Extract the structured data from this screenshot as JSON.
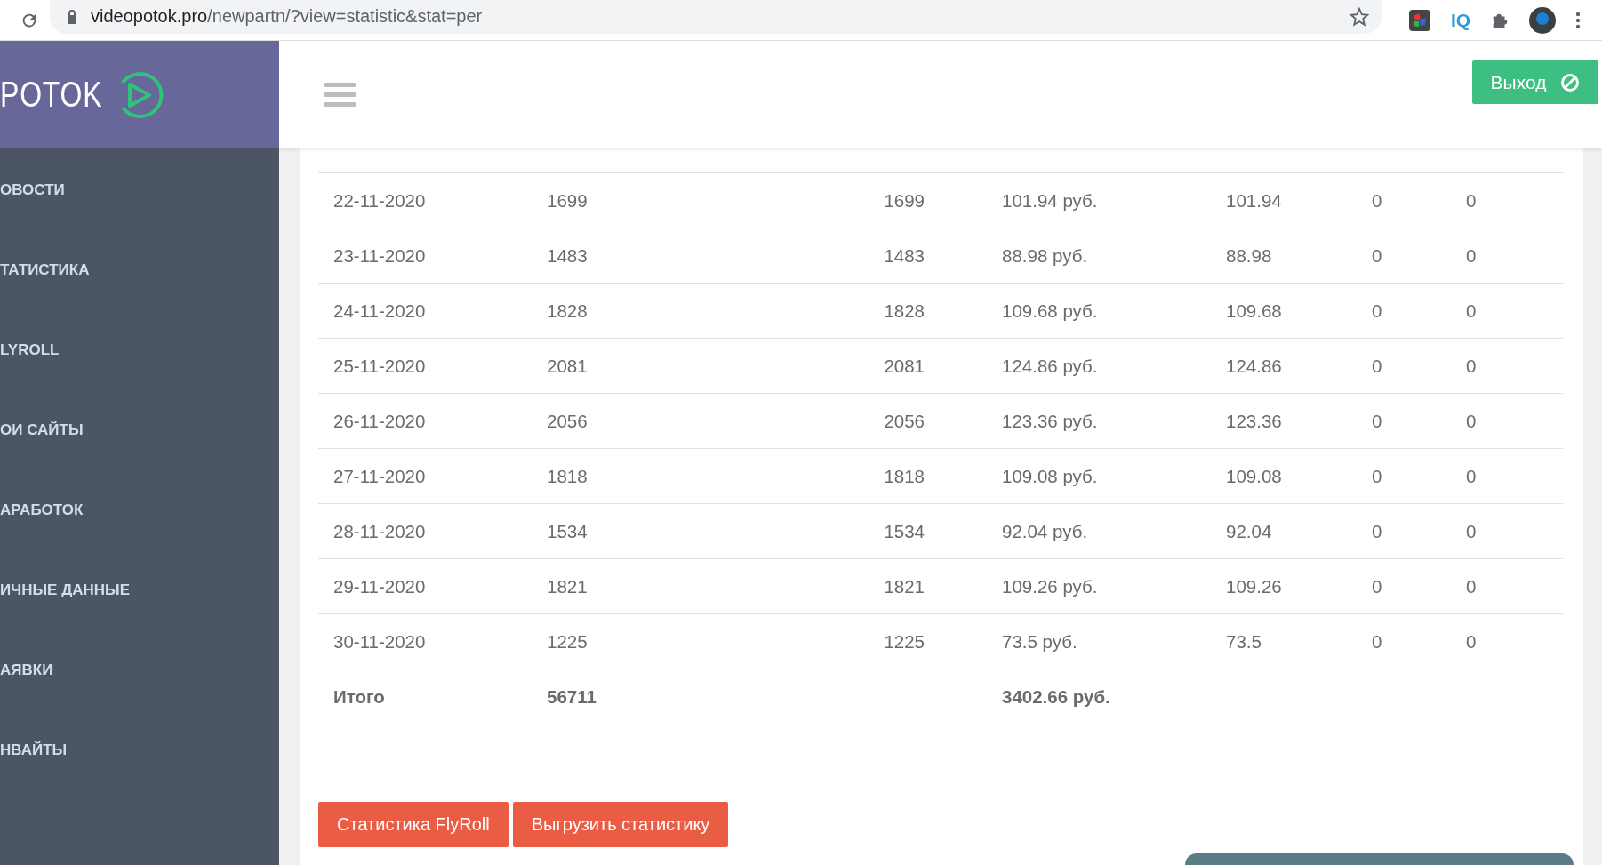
{
  "browser": {
    "url_host": "videopotok.pro",
    "url_path": "/newpartn/?view=statistic&stat=per",
    "extension_label": "IQ"
  },
  "logo": {
    "text": "POTOK"
  },
  "sidebar": {
    "items": [
      {
        "label": "ОВОСТИ"
      },
      {
        "label": "ТАТИСТИКА"
      },
      {
        "label": "LYROLL"
      },
      {
        "label": "ОИ САЙТЫ"
      },
      {
        "label": "АРАБОТОК"
      },
      {
        "label": "ИЧНЫЕ ДАННЫЕ"
      },
      {
        "label": "АЯВКИ"
      },
      {
        "label": "НВАЙТЫ"
      }
    ]
  },
  "header": {
    "logout_button": "Выход"
  },
  "table": {
    "rows": [
      [
        "22-11-2020",
        "1699",
        "1699",
        "101.94 руб.",
        "101.94",
        "0",
        "0"
      ],
      [
        "23-11-2020",
        "1483",
        "1483",
        "88.98 руб.",
        "88.98",
        "0",
        "0"
      ],
      [
        "24-11-2020",
        "1828",
        "1828",
        "109.68 руб.",
        "109.68",
        "0",
        "0"
      ],
      [
        "25-11-2020",
        "2081",
        "2081",
        "124.86 руб.",
        "124.86",
        "0",
        "0"
      ],
      [
        "26-11-2020",
        "2056",
        "2056",
        "123.36 руб.",
        "123.36",
        "0",
        "0"
      ],
      [
        "27-11-2020",
        "1818",
        "1818",
        "109.08 руб.",
        "109.08",
        "0",
        "0"
      ],
      [
        "28-11-2020",
        "1534",
        "1534",
        "92.04 руб.",
        "92.04",
        "0",
        "0"
      ],
      [
        "29-11-2020",
        "1821",
        "1821",
        "109.26 руб.",
        "109.26",
        "0",
        "0"
      ],
      [
        "30-11-2020",
        "1225",
        "1225",
        "73.5 руб.",
        "73.5",
        "0",
        "0"
      ]
    ],
    "total": {
      "label": "Итого",
      "count": "56711",
      "income": "3402.66 руб."
    }
  },
  "buttons": [
    "Статистика FlyRoll",
    "Выгрузить статистику"
  ]
}
